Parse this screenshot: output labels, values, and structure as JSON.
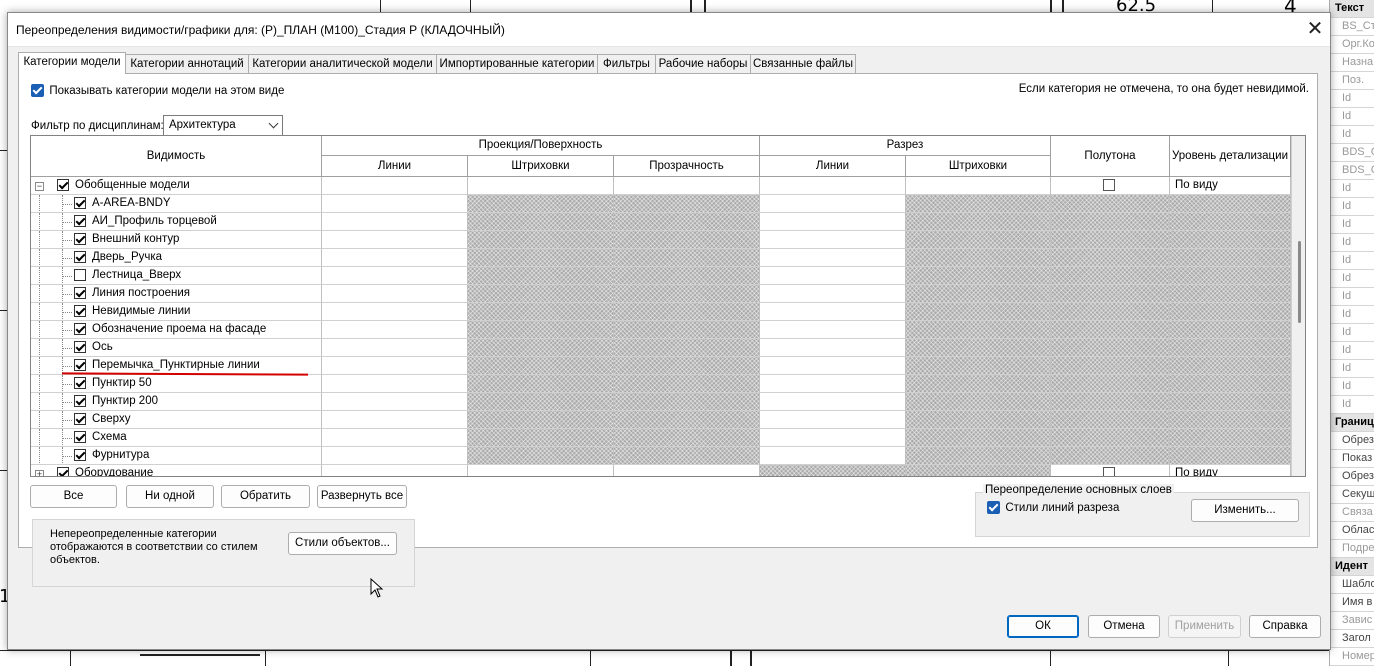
{
  "dialog": {
    "title": "Переопределения видимости/графики для: (Р)_ПЛАН (М100)_Стадия Р (КЛАДОЧНЫЙ)",
    "close_label": "✕"
  },
  "tabs": [
    {
      "label": "Категории модели",
      "active": true
    },
    {
      "label": "Категории аннотаций"
    },
    {
      "label": "Категории аналитической модели"
    },
    {
      "label": "Импортированные категории"
    },
    {
      "label": "Фильтры"
    },
    {
      "label": "Рабочие наборы"
    },
    {
      "label": "Связанные файлы"
    }
  ],
  "show_categories": {
    "label": "Показывать категории модели на этом виде",
    "checked": true
  },
  "hint": "Если категория не отмечена, то она будет невидимой.",
  "discipline_filter": {
    "label": "Фильтр по дисциплинам:",
    "value": "Архитектура"
  },
  "table": {
    "headers": {
      "visibility": "Видимость",
      "projection": "Проекция/Поверхность",
      "cut": "Разрез",
      "lines": "Линии",
      "patterns": "Штриховки",
      "transparency": "Прозрачность",
      "cut_lines": "Линии",
      "cut_patterns": "Штриховки",
      "halftone": "Полутона",
      "detail_level": "Уровень детализации"
    },
    "rows": [
      {
        "name": "Обобщенные модели",
        "checked": true,
        "parent": true,
        "expanded": true,
        "expander": "−",
        "halftone": false,
        "detail": "По виду"
      },
      {
        "name": "A-AREA-BNDY",
        "checked": true
      },
      {
        "name": "АИ_Профиль торцевой",
        "checked": true
      },
      {
        "name": "Внешний контур",
        "checked": true
      },
      {
        "name": "Дверь_Ручка",
        "checked": true
      },
      {
        "name": "Лестница_Вверх",
        "checked": false
      },
      {
        "name": "Линия построения",
        "checked": true
      },
      {
        "name": "Невидимые линии",
        "checked": true
      },
      {
        "name": "Обозначение проема на фасаде",
        "checked": true
      },
      {
        "name": "Ось",
        "checked": true
      },
      {
        "name": "Перемычка_Пунктирные линии",
        "checked": true
      },
      {
        "name": "Пунктир 50",
        "checked": true
      },
      {
        "name": "Пунктир 200",
        "checked": true
      },
      {
        "name": "Сверху",
        "checked": true
      },
      {
        "name": "Схема",
        "checked": true
      },
      {
        "name": "Фурнитура",
        "checked": true
      },
      {
        "name": "Оборудование",
        "checked": true,
        "parent": true,
        "expanded": false,
        "expander": "+",
        "halftone": false,
        "detail": "По виду"
      }
    ]
  },
  "buttons": {
    "all": "Все",
    "none": "Ни одной",
    "invert": "Обратить",
    "expand_all": "Развернуть все",
    "object_styles": "Стили объектов...",
    "edit": "Изменить...",
    "ok": "ОК",
    "cancel": "Отмена",
    "apply": "Применить",
    "help": "Справка"
  },
  "unoverridden_note": "Непереопределенные категории отображаются в соответствии со стилем объектов.",
  "override_layers": {
    "title": "Переопределение основных слоев",
    "cut_line_styles": {
      "label": "Стили линий разреза",
      "checked": true
    }
  },
  "background": {
    "numbers": [
      "62.5",
      "4"
    ],
    "left_mark": "1"
  },
  "properties_panel": {
    "rows": [
      {
        "text": "Текст",
        "head": true
      },
      {
        "text": "BS_Ста",
        "grey": true
      },
      {
        "text": "Орг.Ко",
        "grey": true
      },
      {
        "text": "Назна",
        "grey": true
      },
      {
        "text": "Поз.",
        "grey": true
      },
      {
        "text": "Id",
        "grey": true
      },
      {
        "text": "Id",
        "grey": true
      },
      {
        "text": "Id",
        "grey": true
      },
      {
        "text": "BDS_C",
        "grey": true
      },
      {
        "text": "BDS_C",
        "grey": true
      },
      {
        "text": "Id",
        "grey": true
      },
      {
        "text": "Id",
        "grey": true
      },
      {
        "text": "Id",
        "grey": true
      },
      {
        "text": "Id",
        "grey": true
      },
      {
        "text": "Id",
        "grey": true
      },
      {
        "text": "Id",
        "grey": true
      },
      {
        "text": "Id",
        "grey": true
      },
      {
        "text": "Id",
        "grey": true
      },
      {
        "text": "Id",
        "grey": true
      },
      {
        "text": "Id",
        "grey": true
      },
      {
        "text": "Id",
        "grey": true
      },
      {
        "text": "Id",
        "grey": true
      },
      {
        "text": "Id",
        "grey": true
      },
      {
        "text": "Границ",
        "head": true
      },
      {
        "text": "Обрез"
      },
      {
        "text": "Показ"
      },
      {
        "text": "Обрез"
      },
      {
        "text": "Секущ"
      },
      {
        "text": "Связа",
        "grey": true
      },
      {
        "text": "Облас"
      },
      {
        "text": "Подре",
        "grey": true
      },
      {
        "text": "Идент",
        "head": true
      },
      {
        "text": "Шабло"
      },
      {
        "text": "Имя в"
      },
      {
        "text": "Завис",
        "grey": true
      },
      {
        "text": "Загол"
      },
      {
        "text": "Номер",
        "grey": true
      }
    ]
  }
}
